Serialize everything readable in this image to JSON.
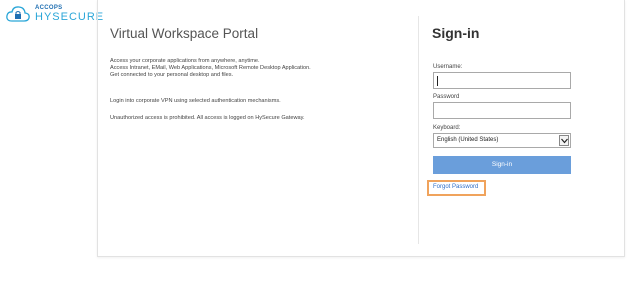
{
  "logo": {
    "brand": "ACCOPS",
    "product": "HYSECURE",
    "icon": "cloud-lock-icon"
  },
  "main": {
    "title": "Virtual Workspace Portal",
    "desc_lines": [
      "Access your corporate applications from anywhere, anytime.",
      "Access Intranet, EMail, Web Applications, Microsoft Remote Desktop Application.",
      "Get connected to your personal desktop and files.",
      "Login into corporate VPN using selected authentication mechanisms.",
      "Unauthorized access is prohibited. All access is logged on HySecure Gateway."
    ]
  },
  "signin": {
    "title": "Sign-in",
    "username_label": "Username:",
    "username_value": "",
    "password_label": "Password",
    "password_value": "",
    "keyboard_label": "Keyboard:",
    "keyboard_selected": "English (United States)",
    "submit_label": "Sign-in",
    "forgot_label": "Forgot Password"
  },
  "colors": {
    "accent": "#6a9edb",
    "highlight": "#f0a35c",
    "link": "#2f6fc7"
  }
}
